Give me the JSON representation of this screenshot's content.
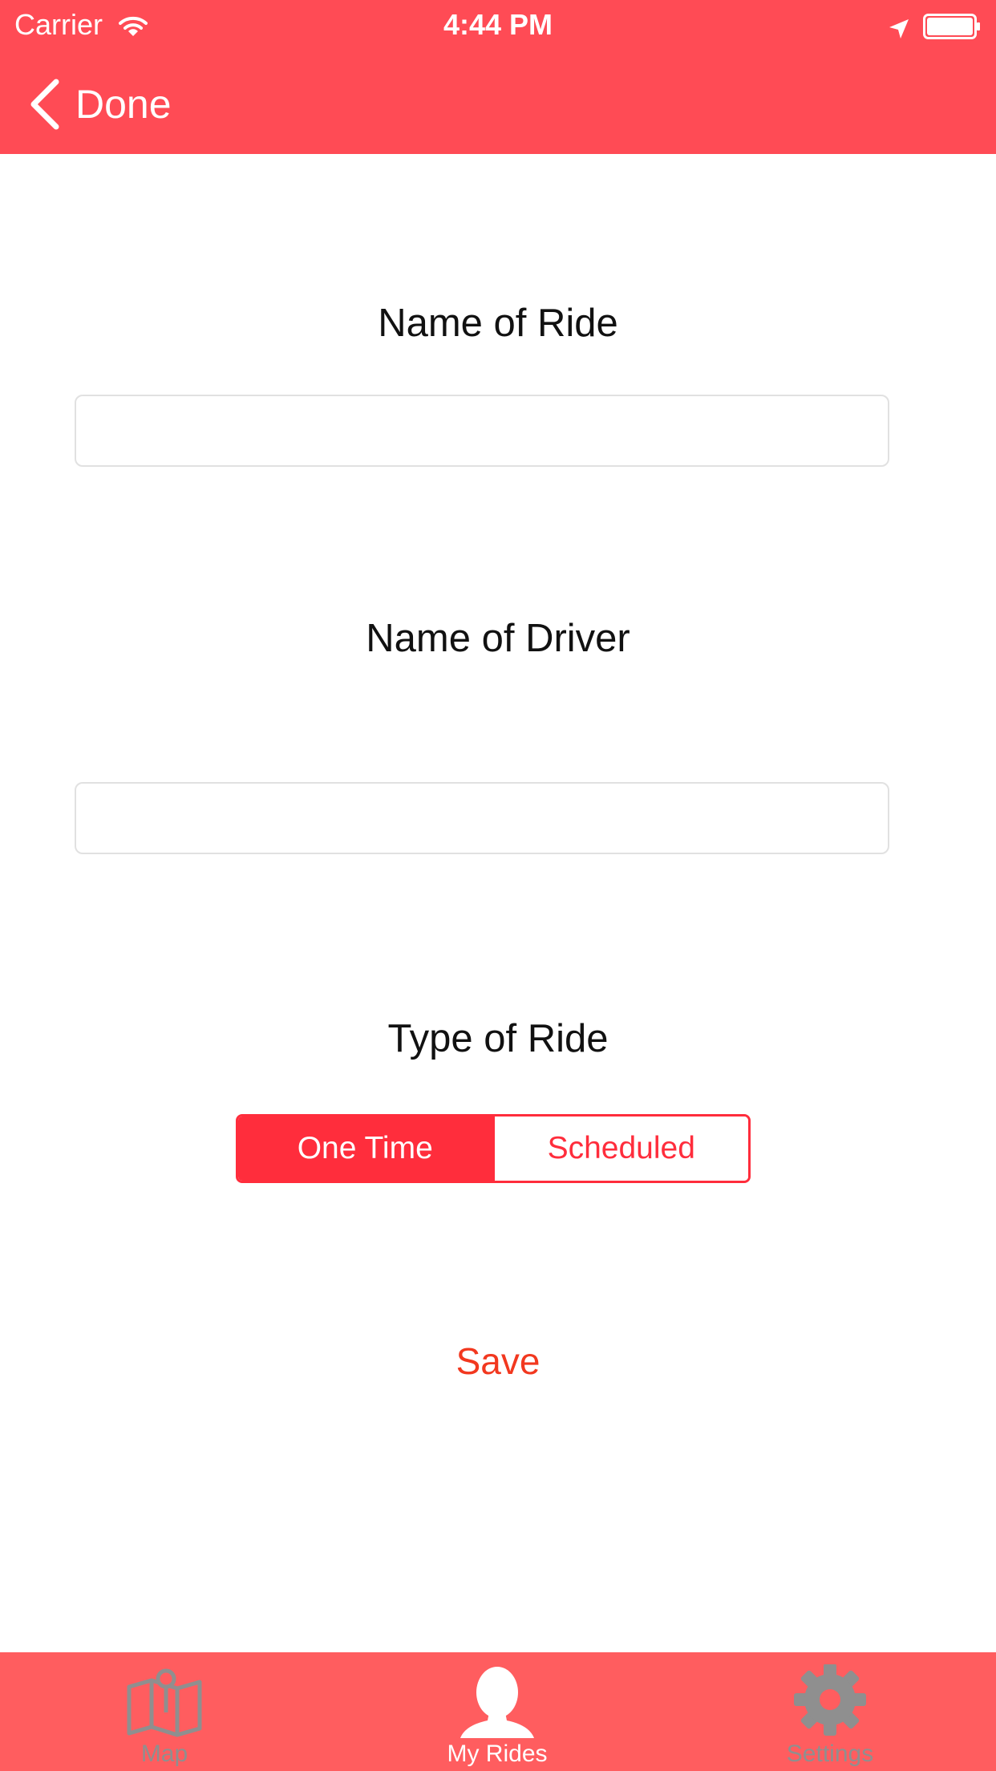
{
  "status_bar": {
    "carrier": "Carrier",
    "time": "4:44 PM"
  },
  "nav": {
    "back_label": "Done"
  },
  "form": {
    "ride_name_label": "Name of Ride",
    "ride_name_value": "",
    "driver_name_label": "Name of Driver",
    "driver_name_value": "",
    "ride_type_label": "Type of Ride",
    "ride_type_options": [
      "One Time",
      "Scheduled"
    ],
    "ride_type_selected": "One Time",
    "save_label": "Save"
  },
  "tab_bar": {
    "items": [
      {
        "label": "Map",
        "icon": "map-icon",
        "active": false
      },
      {
        "label": "My Rides",
        "icon": "person-icon",
        "active": true
      },
      {
        "label": "Settings",
        "icon": "gear-icon",
        "active": false
      }
    ]
  },
  "colors": {
    "nav_bar": "#ff4b55",
    "tab_bar": "#ff5d5f",
    "accent": "#ff2d3c",
    "save_text": "#f2381f",
    "inactive_tab": "#8f8f8f"
  }
}
